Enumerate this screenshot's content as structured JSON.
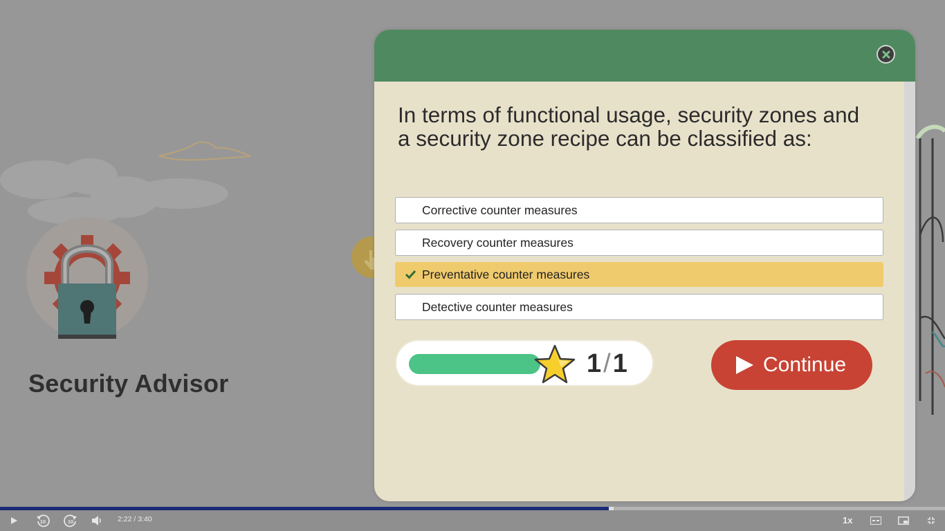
{
  "course": {
    "title": "Security Advisor"
  },
  "quiz": {
    "question": "In terms of functional usage, security zones and a security zone recipe can be classified as:",
    "options": [
      {
        "label": "Corrective counter measures",
        "selected": false
      },
      {
        "label": "Recovery counter measures",
        "selected": false
      },
      {
        "label": "Preventative counter measures",
        "selected": true
      },
      {
        "label": "Detective counter measures",
        "selected": false
      }
    ],
    "progress": {
      "current": "1",
      "total": "1",
      "fraction": 1.0
    },
    "continue_label": "Continue",
    "close_icon": "close-icon"
  },
  "player": {
    "current_time": "2:22",
    "separator": "/",
    "duration": "3:40",
    "played_fraction": 0.645,
    "speed": "1x",
    "icons": [
      "play-icon",
      "rewind-10-icon",
      "forward-10-icon",
      "volume-icon",
      "captions-icon",
      "picture-in-picture-icon",
      "fullscreen-icon"
    ]
  },
  "colors": {
    "header_green": "#4f8960",
    "modal_bg": "#e8e1ca",
    "selected_option": "#f0cb6d",
    "continue_red": "#c84334",
    "progress_green": "#4cc387",
    "seek_fill": "#1b2a74"
  }
}
